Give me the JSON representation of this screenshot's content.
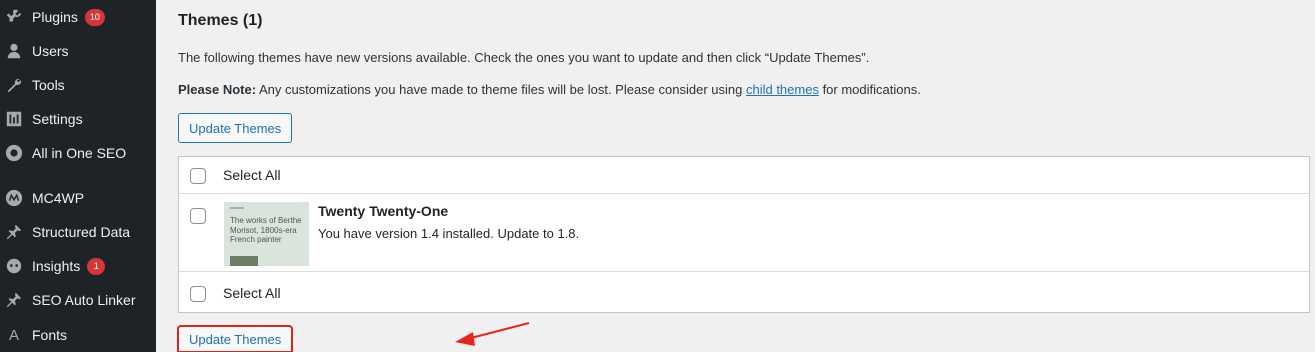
{
  "sidebar": {
    "items": [
      {
        "label": "Plugins",
        "badge": "10",
        "icon": "plugin-icon"
      },
      {
        "label": "Users",
        "icon": "users-icon"
      },
      {
        "label": "Tools",
        "icon": "wrench-icon"
      },
      {
        "label": "Settings",
        "icon": "settings-icon"
      },
      {
        "label": "All in One SEO",
        "icon": "aioseo-icon"
      },
      {
        "label": "MC4WP",
        "icon": "mc4wp-icon"
      },
      {
        "label": "Structured Data",
        "icon": "pin-icon"
      },
      {
        "label": "Insights",
        "badge": "1",
        "icon": "insights-icon"
      },
      {
        "label": "SEO Auto Linker",
        "icon": "pin-icon"
      },
      {
        "label": "Fonts",
        "icon": "font-icon"
      }
    ]
  },
  "main": {
    "title": "Themes (1)",
    "intro": "The following themes have new versions available. Check the ones you want to update and then click “Update Themes”.",
    "note_label": "Please Note:",
    "note_text_before": " Any customizations you have made to theme files will be lost. Please consider using ",
    "note_link": "child themes",
    "note_text_after": " for modifications.",
    "update_button": "Update Themes",
    "select_all": "Select All",
    "theme": {
      "name": "Twenty Twenty-One",
      "info": "You have version 1.4 installed. Update to 1.8.",
      "thumb_text": "The works of Berthe Morisot, 1800s-era French painter"
    }
  },
  "colors": {
    "sidebar_bg": "#1d2327",
    "accent": "#2271b1",
    "badge": "#d63638",
    "highlight": "#d9261c"
  }
}
